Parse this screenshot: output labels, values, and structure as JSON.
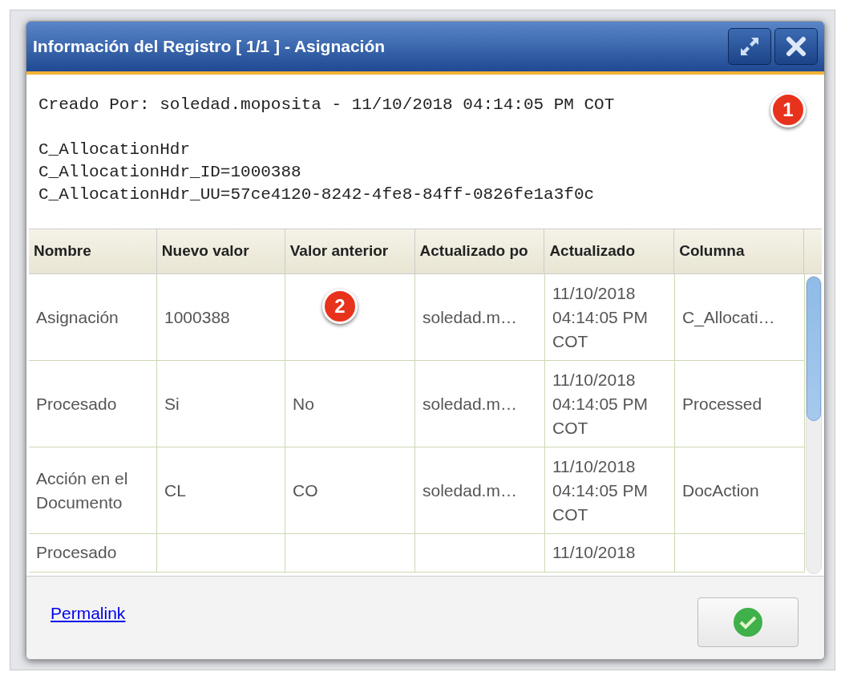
{
  "dialog": {
    "title": "Información del Registro [ 1/1 ] - Asignación",
    "created_by": "Creado Por: soledad.moposita - 11/10/2018 04:14:05 PM COT",
    "info_lines": [
      "C_AllocationHdr",
      "C_AllocationHdr_ID=1000388",
      "C_AllocationHdr_UU=57ce4120-8242-4fe8-84ff-0826fe1a3f0c"
    ],
    "table": {
      "columns": [
        "Nombre",
        "Nuevo valor",
        "Valor anterior",
        "Actualizado po",
        "Actualizado",
        "Columna"
      ],
      "rows": [
        {
          "cells": [
            "Asignación",
            "1000388",
            "",
            "soledad.m…",
            "11/10/2018 04:14:05 PM COT",
            "C_Allocati…"
          ],
          "partial": false
        },
        {
          "cells": [
            "Procesado",
            "Si",
            "No",
            "soledad.m…",
            "11/10/2018 04:14:05 PM COT",
            "Processed"
          ],
          "partial": false
        },
        {
          "cells": [
            "Acción en el Documento",
            "CL",
            "CO",
            "soledad.m…",
            "11/10/2018 04:14:05 PM COT",
            "DocAction"
          ],
          "partial": false
        },
        {
          "cells": [
            "Procesado",
            "",
            "",
            "",
            "11/10/2018",
            ""
          ],
          "partial": true
        }
      ]
    },
    "permalink": "Permalink"
  },
  "callouts": [
    {
      "number": "1"
    },
    {
      "number": "2"
    }
  ]
}
